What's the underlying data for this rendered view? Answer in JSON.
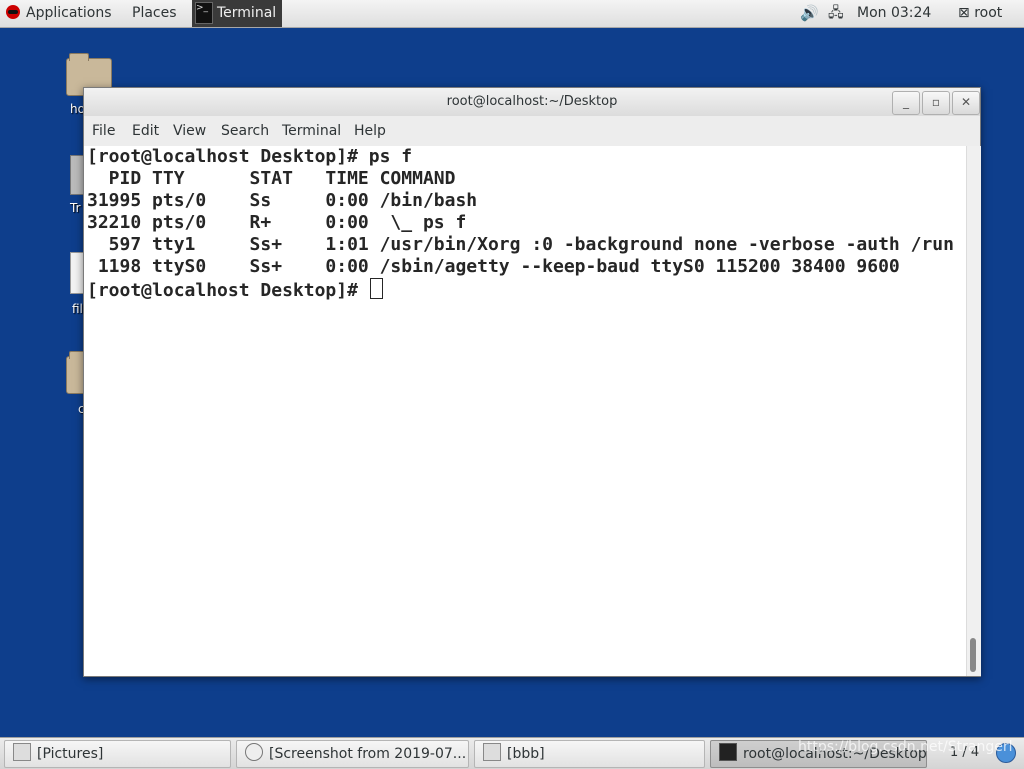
{
  "top_panel": {
    "applications": "Applications",
    "places": "Places",
    "terminal": "Terminal",
    "clock": "Mon 03:24",
    "user": "root"
  },
  "desktop": {
    "icons": [
      {
        "label": "ho"
      },
      {
        "label": "Tr"
      },
      {
        "label": "fil"
      },
      {
        "label": "c"
      }
    ]
  },
  "window": {
    "title": "root@localhost:~/Desktop",
    "menus": [
      "File",
      "Edit",
      "View",
      "Search",
      "Terminal",
      "Help"
    ],
    "lines": [
      "[root@localhost Desktop]# ps f",
      "  PID TTY      STAT   TIME COMMAND",
      "31995 pts/0    Ss     0:00 /bin/bash",
      "32210 pts/0    R+     0:00  \\_ ps f",
      "  597 tty1     Ss+    1:01 /usr/bin/Xorg :0 -background none -verbose -auth /run",
      " 1198 ttyS0    Ss+    0:00 /sbin/agetty --keep-baud ttyS0 115200 38400 9600",
      "[root@localhost Desktop]# "
    ]
  },
  "taskbar": {
    "tasks": [
      {
        "label": "[Pictures]",
        "icon": "window-icon"
      },
      {
        "label": "[Screenshot from 2019-07...",
        "icon": "image-viewer-icon"
      },
      {
        "label": "[bbb]",
        "icon": "window-icon"
      },
      {
        "label": "root@localhost:~/Desktop",
        "icon": "terminal-icon"
      }
    ],
    "workspace": "1 / 4"
  },
  "watermark": "https://blog.csdn.net/Strangerl"
}
